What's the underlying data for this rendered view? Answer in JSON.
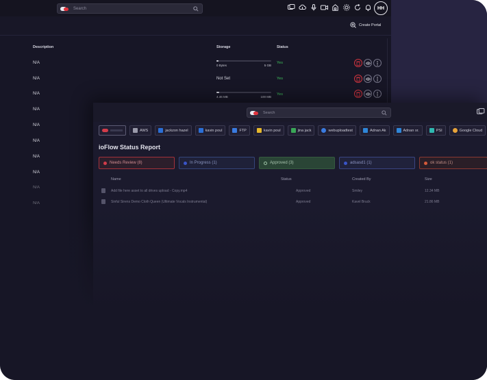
{
  "back_window": {
    "search": {
      "placeholder": "Search"
    },
    "topbar_icons": [
      "image-share-icon",
      "cloud-upload-icon",
      "microphone-icon",
      "video-icon",
      "home-icon",
      "settings-icon",
      "refresh-icon",
      "bell-icon"
    ],
    "avatar_initials": "HH",
    "create_portal_label": "Create Portal",
    "columns": {
      "description": "Description",
      "storage": "Storage",
      "status": "Status"
    },
    "rows": [
      {
        "description": "N/A",
        "storage_used": "0 Bytes",
        "storage_total": "5 GB",
        "storage_fraction": 0.0,
        "status": "Yes",
        "has_actions": true
      },
      {
        "description": "N/A",
        "storage_text": "Not Set",
        "status": "Yes",
        "has_actions": true
      },
      {
        "description": "N/A",
        "storage_used": "4.46 MB",
        "storage_total": "100 MB",
        "storage_fraction": 0.045,
        "status": "Yes",
        "has_actions": true
      },
      {
        "description": "N/A"
      },
      {
        "description": "N/A"
      },
      {
        "description": "N/A"
      },
      {
        "description": "N/A"
      },
      {
        "description": "N/A"
      },
      {
        "description": "N/A"
      },
      {
        "description": "N/A"
      }
    ]
  },
  "front_window": {
    "search": {
      "placeholder": "Search"
    },
    "chips": [
      {
        "label": "",
        "color": "#d23c4a"
      },
      {
        "label": "AWS",
        "color": "#9a9aaa"
      },
      {
        "label": "jackzon hazel",
        "color": "#2b6fd6"
      },
      {
        "label": "kavin poul",
        "color": "#2b6fd6"
      },
      {
        "label": "FTP",
        "color": "#3a7be0"
      },
      {
        "label": "kavin poul",
        "color": "#e6b82c"
      },
      {
        "label": "jina jack",
        "color": "#3aa757"
      },
      {
        "label": "webuploadtest",
        "color": "#3a7be0"
      },
      {
        "label": "Adnan Ak",
        "color": "#2f86d8"
      },
      {
        "label": "Adnan sr.",
        "color": "#2f86d8"
      },
      {
        "label": "PSI",
        "color": "#2fb7b0"
      },
      {
        "label": "Google Cloud",
        "color": "#e8a43a"
      }
    ],
    "title": "ioFlow Status Report",
    "cards": [
      {
        "label": "Needs Review (8)",
        "color": "#d23c4a"
      },
      {
        "label": "In Progress (1)",
        "color": "#3a55c8"
      },
      {
        "label": "Approved (3)",
        "color": "#4aa866"
      },
      {
        "label": "adsasd1 (1)",
        "color": "#3a55c8"
      },
      {
        "label": "ok status (1)",
        "color": "#d45a3a"
      }
    ],
    "columns": {
      "name": "Name",
      "status": "Status",
      "created_by": "Created By",
      "size": "Size"
    },
    "rows": [
      {
        "name": "Add file here asset to all drives upload - Copy.mp4",
        "status": "Approved",
        "created_by": "Smiley",
        "size": "12.34 MB"
      },
      {
        "name": "Sinful Sirens Demo Cloth Queen (Ultimate Vocals Instrumental)",
        "status": "Approved",
        "created_by": "Kavel Bruck",
        "size": "21.86 MB"
      }
    ]
  }
}
